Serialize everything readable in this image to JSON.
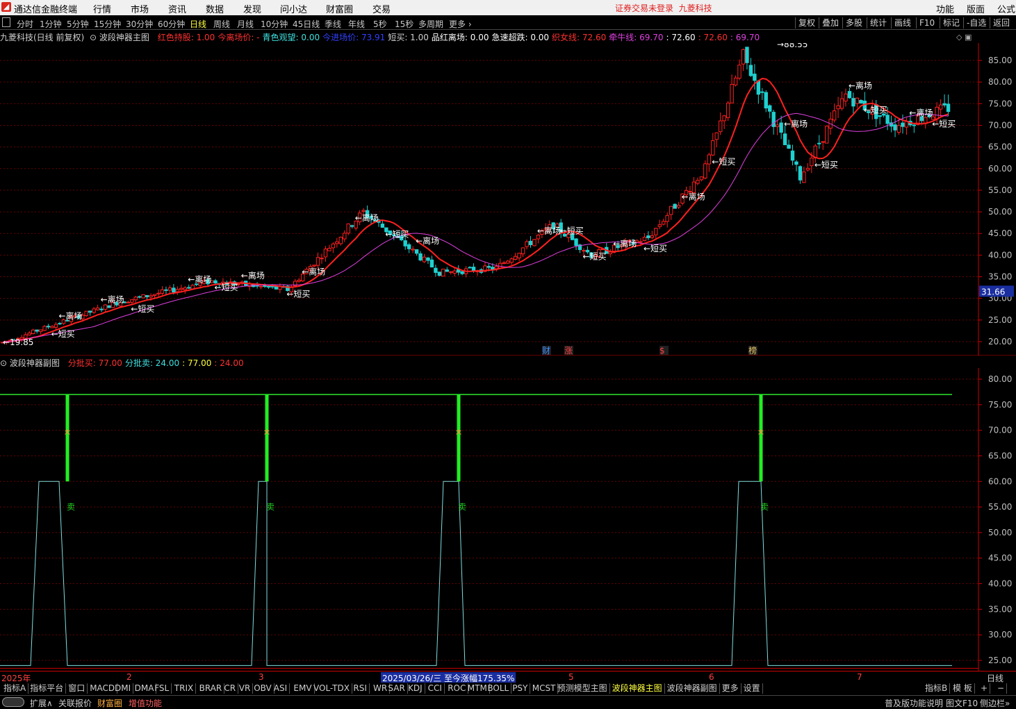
{
  "menubar": {
    "app_title": "通达信金融终端",
    "menus": [
      "行情",
      "市场",
      "资讯",
      "数据",
      "发现",
      "问小达",
      "财富圈",
      "交易"
    ],
    "warning": "证券交易未登录",
    "stock_name": "九菱科技",
    "right_menus": [
      "功能",
      "版面",
      "公式"
    ]
  },
  "periods": [
    "分时",
    "1分钟",
    "5分钟",
    "15分钟",
    "30分钟",
    "60分钟",
    "日线",
    "周线",
    "月线",
    "10分钟",
    "45日线",
    "季线",
    "年线",
    "5秒",
    "15秒",
    "多周期",
    "更多"
  ],
  "active_period": "日线",
  "right_buttons": [
    "复权",
    "叠加",
    "多股",
    "统计",
    "画线",
    "F10",
    "标记",
    "-自选",
    "返回"
  ],
  "main_info": {
    "title": "九菱科技(日线 前复权)",
    "indicator": "波段神器主图",
    "items": [
      {
        "text": "红色持股: 1.00",
        "color": "#ff3030"
      },
      {
        "text": "今离场价: -",
        "color": "#ff3030"
      },
      {
        "text": "青色观望: 0.00",
        "color": "#40e0e0"
      },
      {
        "text": "今进场价: 73.91",
        "color": "#3040ff"
      },
      {
        "text": "短买: 1.00",
        "color": "#d0d0d0"
      },
      {
        "text": "品红离场: 0.00",
        "color": "#ffffff"
      },
      {
        "text": "急速超跌: 0.00",
        "color": "#ffffff"
      },
      {
        "text": "织女线: 72.60",
        "color": "#ff3030"
      },
      {
        "text": "牵牛线: 69.70",
        "color": "#e040e0"
      },
      {
        "text": ": 72.60",
        "color": "#ffffff"
      },
      {
        "text": ": 72.60",
        "color": "#ff3030"
      },
      {
        "text": ": 69.70",
        "color": "#e040e0"
      }
    ]
  },
  "main_axis": [
    "85.00",
    "80.00",
    "75.00",
    "70.00",
    "65.00",
    "60.00",
    "55.00",
    "50.00",
    "45.00",
    "40.00",
    "35.00",
    "30.00",
    "25.00",
    "20.00"
  ],
  "current_price": "31.66",
  "high_label": "88.55",
  "low_label": "19.85",
  "signal_labels": {
    "buy": "短买",
    "sell": "离场"
  },
  "event_markers": [
    "财",
    "涨",
    "$",
    "榜"
  ],
  "sub_info": {
    "indicator": "波段神器副图",
    "items": [
      {
        "text": "分批买: 77.00",
        "color": "#ff3030"
      },
      {
        "text": "分批卖: 24.00",
        "color": "#40e0e0"
      },
      {
        "text": ": 77.00",
        "color": "#ffff40"
      },
      {
        "text": ": 24.00",
        "color": "#ff3030"
      }
    ]
  },
  "sub_axis": [
    "80.00",
    "75.00",
    "70.00",
    "65.00",
    "60.00",
    "55.00",
    "50.00",
    "45.00",
    "40.00",
    "35.00",
    "30.00",
    "25.00"
  ],
  "sub_sell_label": "卖",
  "date_axis": [
    "2025年",
    "2",
    "3",
    "2025/03/26/三  至今涨幅175.35%",
    "5",
    "6",
    "7"
  ],
  "date_axis_right": "日线",
  "tabs": [
    "指标A",
    "指标平台",
    "窗口",
    "MACD",
    "DMI",
    "DMA",
    "FSL",
    "TRIX",
    "BRAR",
    "CR",
    "VR",
    "OBV",
    "ASI",
    "EMV",
    "VOL-TDX",
    "RSI",
    "WR",
    "SAR",
    "KDJ",
    "CCI",
    "ROC",
    "MTM",
    "BOLL",
    "PSY",
    "MCST",
    "预测模型主图",
    "波段神器主图",
    "波段神器副图",
    "更多",
    "设置"
  ],
  "active_tab": "波段神器主图",
  "tab_right": [
    "指标B",
    "模 板",
    "+",
    "−"
  ],
  "status_left": [
    "扩展∧",
    "关联报价",
    "财富圈",
    "增值功能"
  ],
  "status_right": [
    "普及版功能说明",
    "图文F10",
    "侧边栏»"
  ],
  "chart_data": {
    "type": "candlestick",
    "title": "九菱科技(日线 前复权)",
    "ylim": [
      18,
      90
    ],
    "y_ticks": [
      20,
      25,
      30,
      35,
      40,
      45,
      50,
      55,
      60,
      65,
      70,
      75,
      80,
      85
    ],
    "highest": 88.55,
    "lowest": 19.85,
    "last_close": 31.66,
    "sessions": [
      {
        "segment": "Jan",
        "start": 19.8,
        "end": 29
      },
      {
        "segment": "Feb",
        "start": 29,
        "end": 34
      },
      {
        "segment": "Mar",
        "start": 33,
        "end": 50
      },
      {
        "segment": "Apr",
        "start": 49,
        "end": 36
      },
      {
        "segment": "May",
        "start": 36,
        "end": 47
      },
      {
        "segment": "Jun",
        "start": 47,
        "end": 72
      },
      {
        "segment": "Jul",
        "start": 72,
        "end": 74
      }
    ],
    "ma_red_end": 72.6,
    "ma_magenta_end": 69.7,
    "sub_chart": {
      "type": "step",
      "ylim": [
        24,
        82
      ],
      "buy_level": 77,
      "sell_level": 24,
      "peaks": [
        60,
        60,
        60,
        60
      ]
    }
  }
}
